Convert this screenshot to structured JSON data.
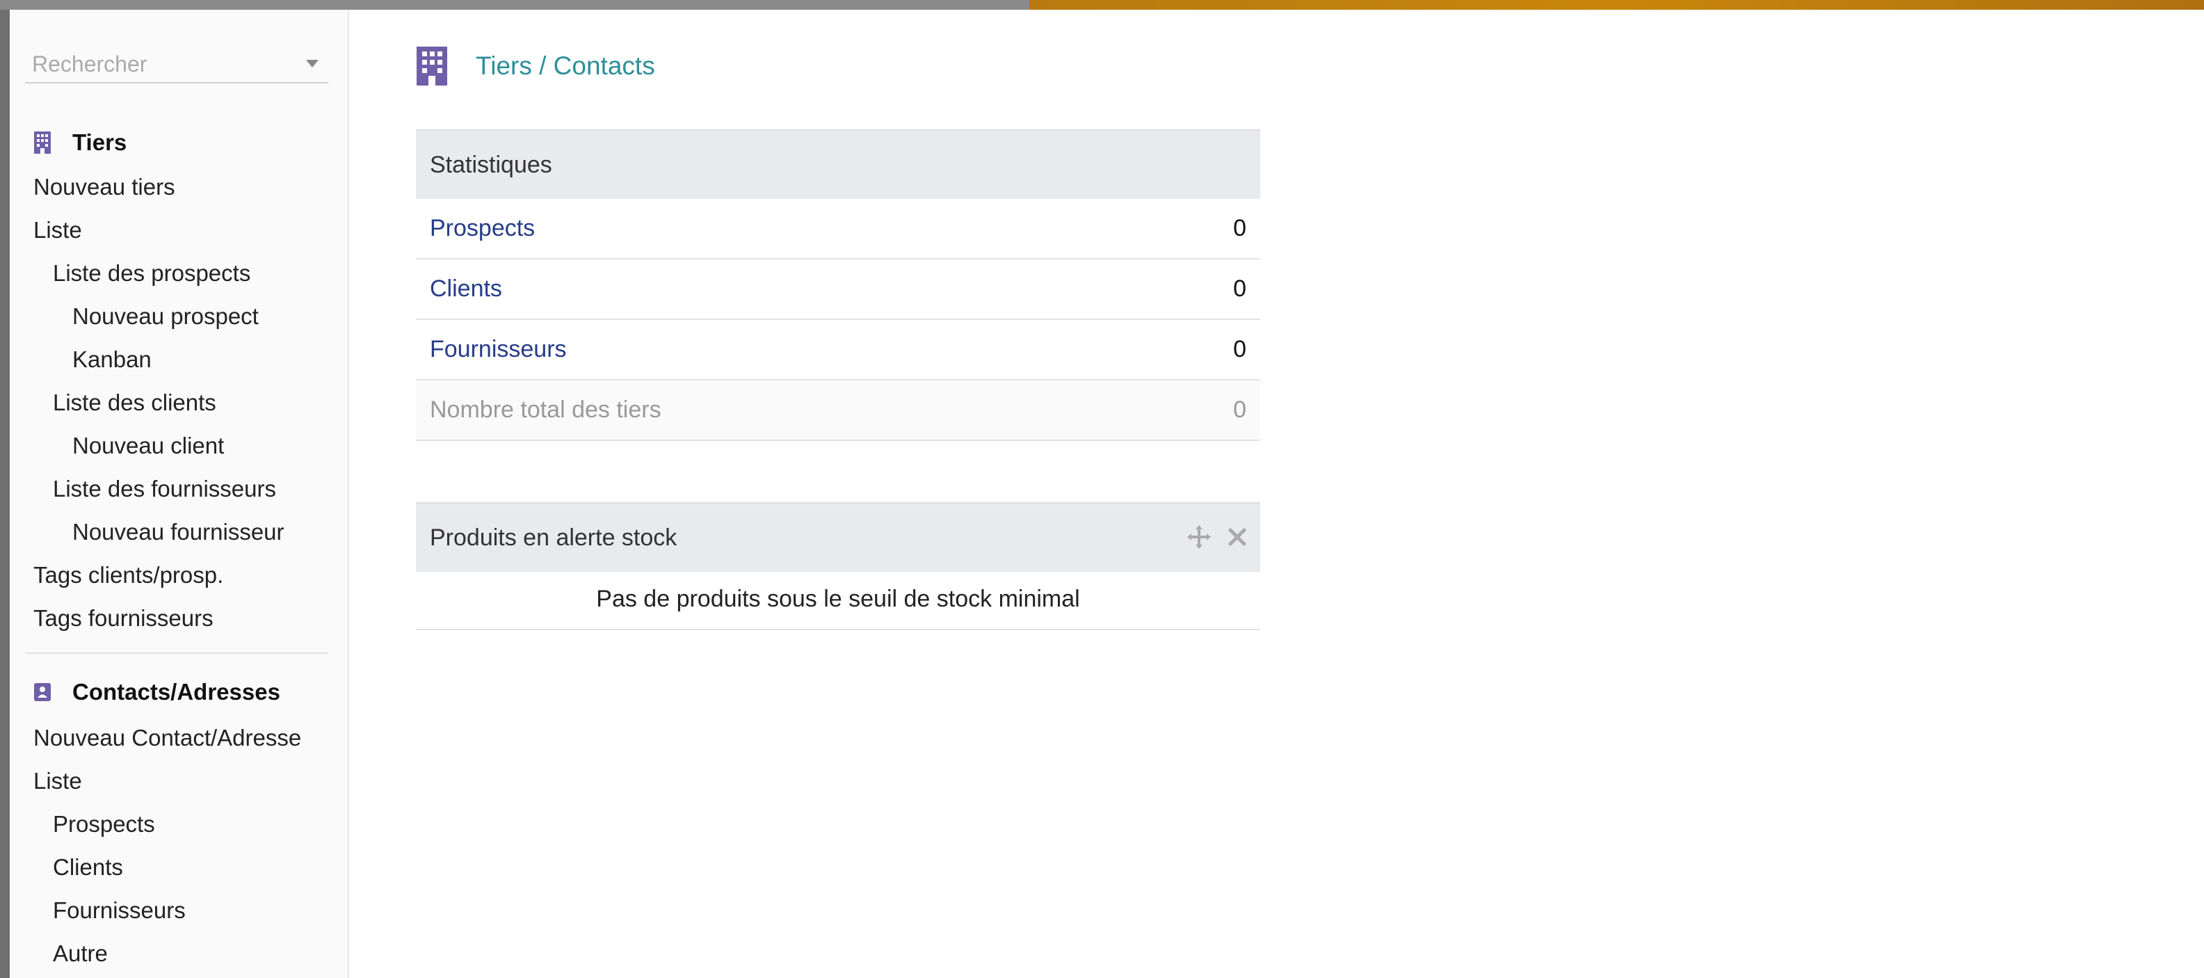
{
  "sidebar": {
    "search": {
      "placeholder": "Rechercher"
    },
    "tiers": {
      "title": "Tiers",
      "items": [
        "Nouveau tiers",
        "Liste",
        "Liste des prospects",
        "Nouveau prospect",
        "Kanban",
        "Liste des clients",
        "Nouveau client",
        "Liste des fournisseurs",
        "Nouveau fournisseur",
        "Tags clients/prosp.",
        "Tags fournisseurs"
      ]
    },
    "contacts": {
      "title": "Contacts/Adresses",
      "items": [
        "Nouveau Contact/Adresse",
        "Liste",
        "Prospects",
        "Clients",
        "Fournisseurs",
        "Autre"
      ]
    }
  },
  "main": {
    "title": "Tiers / Contacts",
    "stats": {
      "header": "Statistiques",
      "rows": [
        {
          "label": "Prospects",
          "value": "0"
        },
        {
          "label": "Clients",
          "value": "0"
        },
        {
          "label": "Fournisseurs",
          "value": "0"
        },
        {
          "label": "Nombre total des tiers",
          "value": "0"
        }
      ]
    },
    "stock_alert": {
      "header": "Produits en alerte stock",
      "message": "Pas de produits sous le seuil de stock minimal"
    }
  },
  "colors": {
    "accent": "#2f8e9a",
    "link": "#263c8a",
    "icon": "#6e5fa8",
    "chrome_accent": "#c8860c"
  },
  "icons": {
    "tiers": "building-icon",
    "contacts": "address-book-icon",
    "move": "move-icon",
    "close": "close-icon"
  }
}
